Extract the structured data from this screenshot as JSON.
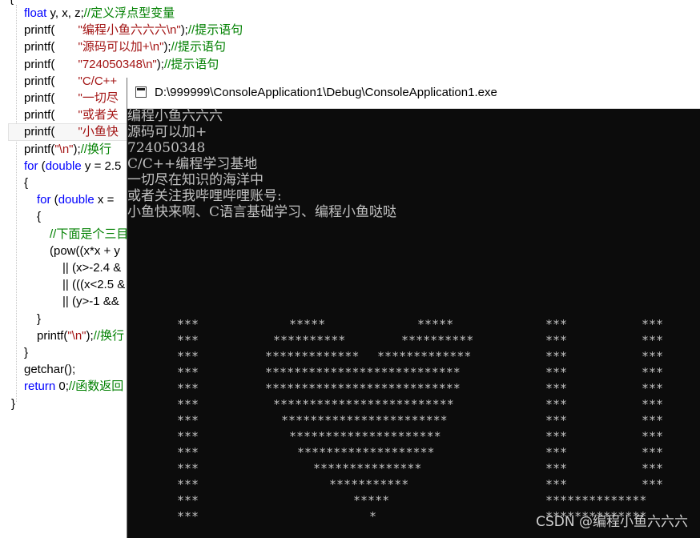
{
  "editor": {
    "lines": [
      {
        "indent": 30,
        "parts": [
          {
            "t": "float",
            "c": "kw"
          },
          {
            "t": " y, x, z;"
          },
          {
            "t": "//定义浮点型变量",
            "c": "cmt"
          }
        ]
      },
      {
        "indent": 30,
        "parts": [
          {
            "t": "printf(       "
          },
          {
            "t": "\"编程小鱼六六六\\n\"",
            "c": "str"
          },
          {
            "t": ");"
          },
          {
            "t": "//提示语句",
            "c": "cmt"
          }
        ]
      },
      {
        "indent": 30,
        "parts": [
          {
            "t": "printf(       "
          },
          {
            "t": "\"源码可以加+\\n\"",
            "c": "str"
          },
          {
            "t": ");"
          },
          {
            "t": "//提示语句",
            "c": "cmt"
          }
        ]
      },
      {
        "indent": 30,
        "parts": [
          {
            "t": "printf(       "
          },
          {
            "t": "\"724050348\\n\"",
            "c": "str"
          },
          {
            "t": ");"
          },
          {
            "t": "//提示语句",
            "c": "cmt"
          }
        ]
      },
      {
        "indent": 30,
        "parts": [
          {
            "t": "printf(       "
          },
          {
            "t": "\"C/C++",
            "c": "str"
          }
        ]
      },
      {
        "indent": 30,
        "parts": [
          {
            "t": "printf(       "
          },
          {
            "t": "\"一切尽",
            "c": "str"
          }
        ]
      },
      {
        "indent": 30,
        "parts": [
          {
            "t": "printf(       "
          },
          {
            "t": "\"或者关",
            "c": "str"
          }
        ]
      },
      {
        "indent": 30,
        "parts": [
          {
            "t": "printf(       "
          },
          {
            "t": "\"小鱼快",
            "c": "str"
          }
        ]
      },
      {
        "indent": 30,
        "parts": [
          {
            "t": "printf("
          },
          {
            "t": "\"\\n\"",
            "c": "str"
          },
          {
            "t": ");"
          },
          {
            "t": "//换行",
            "c": "cmt"
          }
        ]
      },
      {
        "indent": 30,
        "parts": [
          {
            "t": "for",
            "c": "kw"
          },
          {
            "t": " ("
          },
          {
            "t": "double",
            "c": "kw"
          },
          {
            "t": " y = 2.5"
          }
        ]
      },
      {
        "indent": 30,
        "parts": [
          {
            "t": "{"
          }
        ]
      },
      {
        "indent": 46,
        "parts": [
          {
            "t": "for",
            "c": "kw"
          },
          {
            "t": " ("
          },
          {
            "t": "double",
            "c": "kw"
          },
          {
            "t": " x = "
          }
        ]
      },
      {
        "indent": 46,
        "parts": [
          {
            "t": "{"
          }
        ]
      },
      {
        "indent": 62,
        "parts": [
          {
            "t": "//下面是个三目",
            "c": "cmt"
          }
        ]
      },
      {
        "indent": 62,
        "parts": [
          {
            "t": "(pow((x*x + y"
          }
        ]
      },
      {
        "indent": 78,
        "parts": [
          {
            "t": "|| (x>-2.4 &"
          }
        ]
      },
      {
        "indent": 78,
        "parts": [
          {
            "t": "|| (((x<2.5 &"
          }
        ]
      },
      {
        "indent": 78,
        "parts": [
          {
            "t": "|| (y>-1 &&"
          }
        ]
      },
      {
        "indent": 46,
        "parts": [
          {
            "t": "}"
          }
        ]
      },
      {
        "indent": 46,
        "parts": [
          {
            "t": "printf("
          },
          {
            "t": "\"\\n\"",
            "c": "str"
          },
          {
            "t": ");"
          },
          {
            "t": "//换行",
            "c": "cmt"
          }
        ]
      },
      {
        "indent": 30,
        "parts": [
          {
            "t": "}"
          }
        ]
      },
      {
        "indent": 30,
        "parts": [
          {
            "t": "getchar();"
          }
        ]
      },
      {
        "indent": 30,
        "parts": [
          {
            "t": "return",
            "c": "kw"
          },
          {
            "t": " 0;"
          },
          {
            "t": "//函数返回",
            "c": "cmt"
          }
        ]
      },
      {
        "indent": 14,
        "parts": [
          {
            "t": "}"
          }
        ]
      }
    ],
    "top_brace": "{"
  },
  "console": {
    "title": "D:\\999999\\ConsoleApplication1\\Debug\\ConsoleApplication1.exe",
    "output": [
      "编程小鱼六六六",
      "源码可以加+",
      "724050348",
      "C/C++编程学习基地",
      "一切尽在知识的海洋中",
      "或者关注我哔哩哔哩账号:",
      "小鱼快来啊、C语言基础学习、编程小鱼哒哒"
    ],
    "art": [
      [
        [
          220,
          "***"
        ],
        [
          360,
          "*****"
        ],
        [
          520,
          "*****"
        ],
        [
          680,
          "***"
        ],
        [
          800,
          "***"
        ]
      ],
      [
        [
          220,
          "***"
        ],
        [
          340,
          "**********"
        ],
        [
          500,
          "**********"
        ],
        [
          680,
          "***"
        ],
        [
          800,
          "***"
        ]
      ],
      [
        [
          220,
          "***"
        ],
        [
          330,
          "*************"
        ],
        [
          470,
          "*************"
        ],
        [
          680,
          "***"
        ],
        [
          800,
          "***"
        ]
      ],
      [
        [
          220,
          "***"
        ],
        [
          330,
          "***************************"
        ],
        [
          680,
          "***"
        ],
        [
          800,
          "***"
        ]
      ],
      [
        [
          220,
          "***"
        ],
        [
          330,
          "***************************"
        ],
        [
          680,
          "***"
        ],
        [
          800,
          "***"
        ]
      ],
      [
        [
          220,
          "***"
        ],
        [
          340,
          "*************************"
        ],
        [
          680,
          "***"
        ],
        [
          800,
          "***"
        ]
      ],
      [
        [
          220,
          "***"
        ],
        [
          350,
          "***********************"
        ],
        [
          680,
          "***"
        ],
        [
          800,
          "***"
        ]
      ],
      [
        [
          220,
          "***"
        ],
        [
          360,
          "*********************"
        ],
        [
          680,
          "***"
        ],
        [
          800,
          "***"
        ]
      ],
      [
        [
          220,
          "***"
        ],
        [
          370,
          "*******************"
        ],
        [
          680,
          "***"
        ],
        [
          800,
          "***"
        ]
      ],
      [
        [
          220,
          "***"
        ],
        [
          390,
          "***************"
        ],
        [
          680,
          "***"
        ],
        [
          800,
          "***"
        ]
      ],
      [
        [
          220,
          "***"
        ],
        [
          410,
          "***********"
        ],
        [
          680,
          "***"
        ],
        [
          800,
          "***"
        ]
      ],
      [
        [
          220,
          "***"
        ],
        [
          440,
          "*****"
        ],
        [
          680,
          "**************"
        ]
      ],
      [
        [
          220,
          "***"
        ],
        [
          460,
          "*"
        ],
        [
          680,
          "**************"
        ]
      ]
    ]
  },
  "watermark": "CSDN @编程小鱼六六六"
}
